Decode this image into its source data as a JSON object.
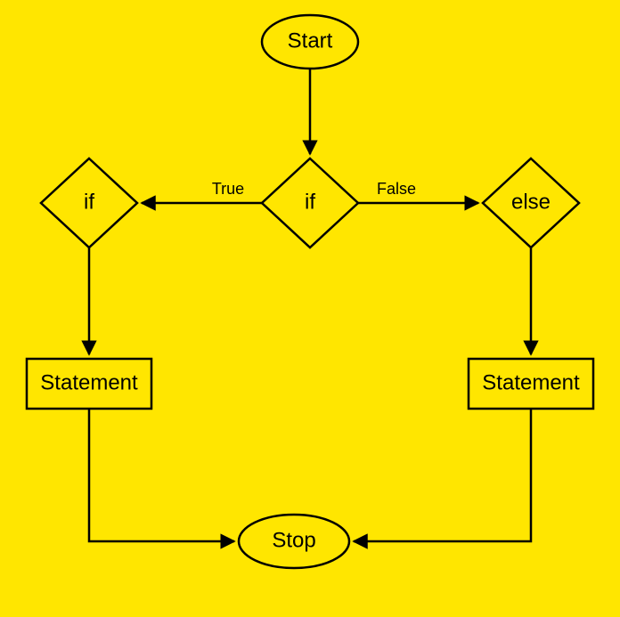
{
  "flowchart": {
    "background_color": "#ffe600",
    "stroke_color": "#000000",
    "nodes": {
      "start": {
        "label": "Start"
      },
      "decision_top": {
        "label": "if"
      },
      "decision_l": {
        "label": "if"
      },
      "decision_r": {
        "label": "else"
      },
      "stmt_l": {
        "label": "Statement"
      },
      "stmt_r": {
        "label": "Statement"
      },
      "stop": {
        "label": "Stop"
      }
    },
    "edge_labels": {
      "true": "True",
      "false": "False"
    }
  }
}
